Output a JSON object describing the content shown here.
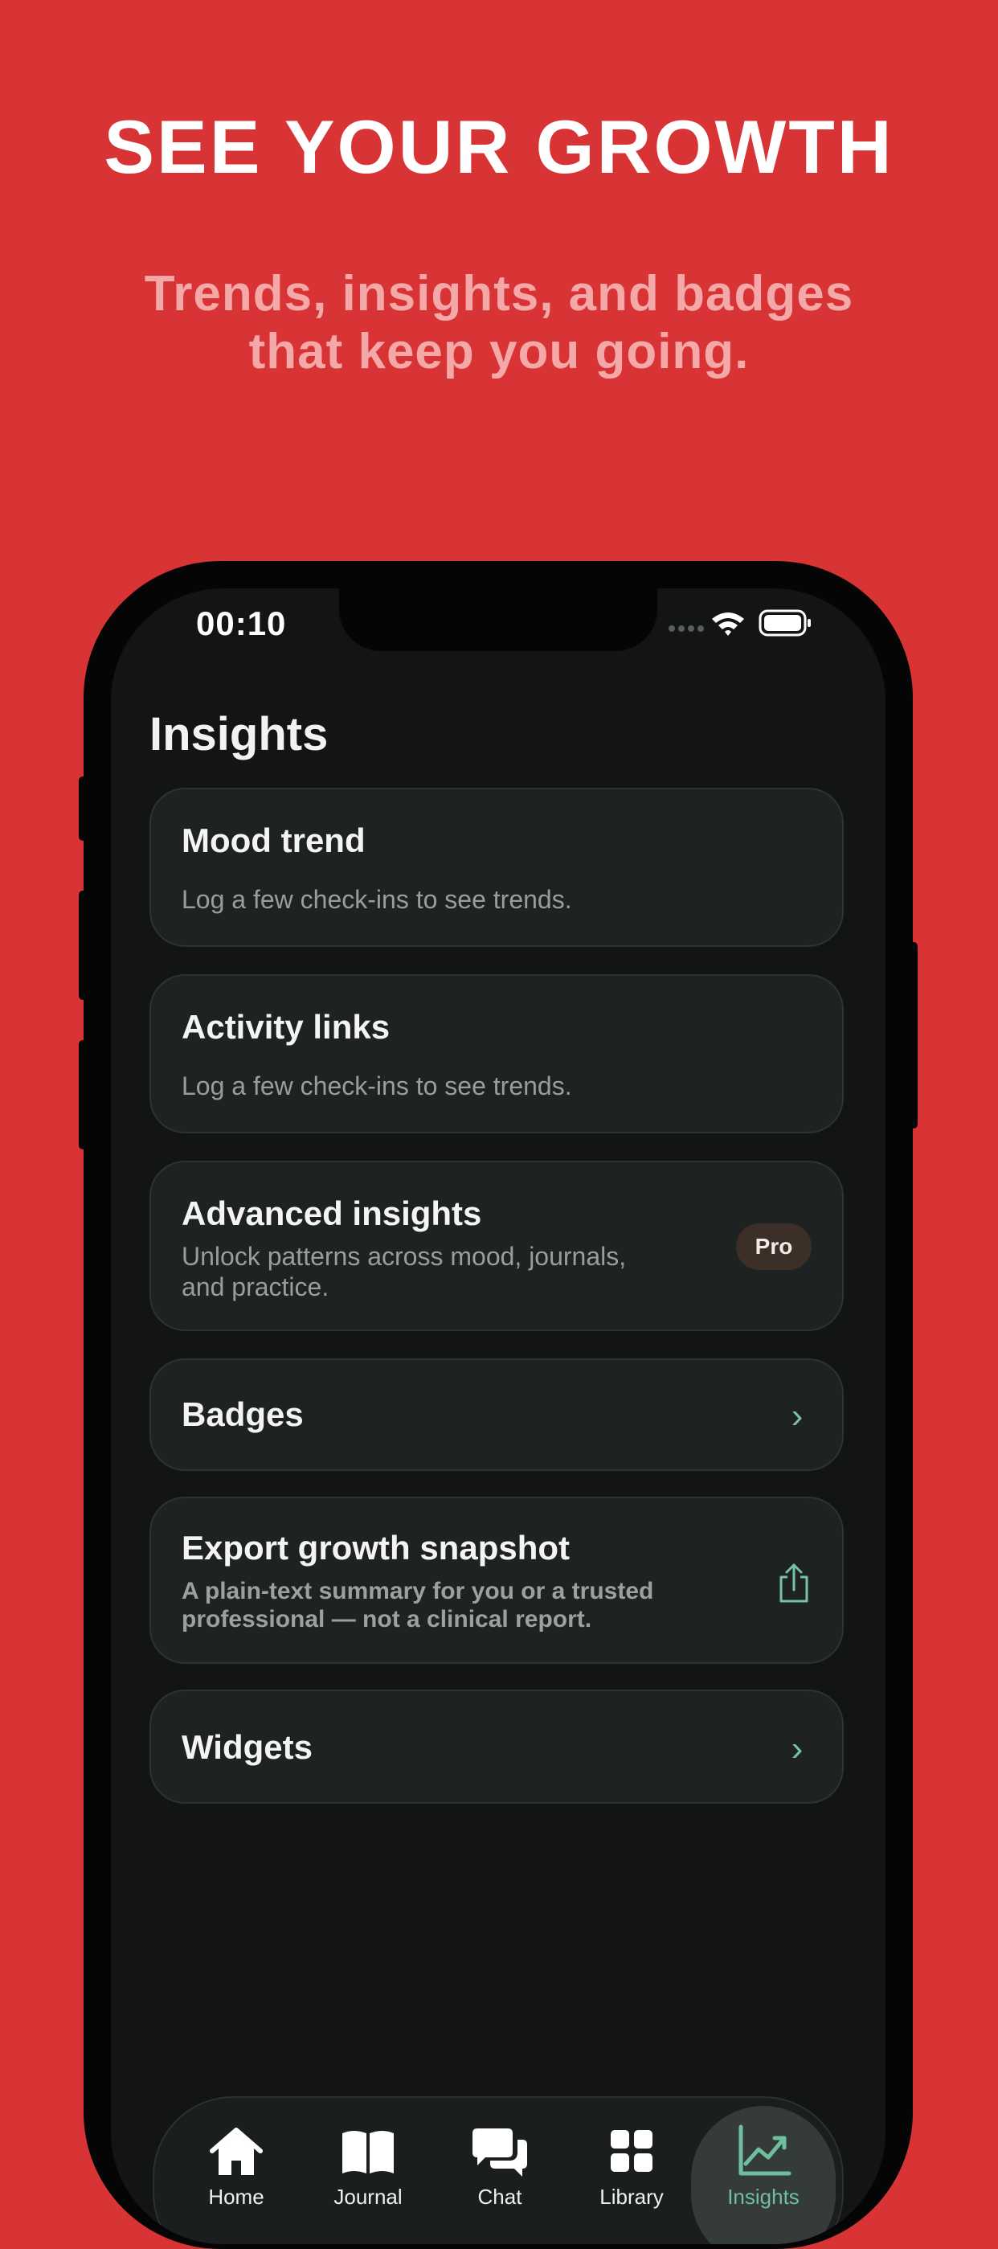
{
  "promo": {
    "headline": "SEE YOUR GROWTH",
    "subhead_line1": "Trends, insights, and badges",
    "subhead_line2": "that keep you going."
  },
  "status_bar": {
    "time": "00:10"
  },
  "screen": {
    "title": "Insights"
  },
  "cards": {
    "mood": {
      "title": "Mood trend",
      "subtitle": "Log a few check-ins to see trends."
    },
    "activity": {
      "title": "Activity links",
      "subtitle": "Log a few check-ins to see trends."
    },
    "advanced": {
      "title": "Advanced insights",
      "subtitle_line1": "Unlock patterns across mood, journals,",
      "subtitle_line2": "and practice.",
      "badge": "Pro"
    },
    "badges": {
      "title": "Badges"
    },
    "export": {
      "title": "Export growth snapshot",
      "subtitle_line1": "A plain-text summary for you or a trusted",
      "subtitle_line2": "professional — not a clinical report."
    },
    "widgets": {
      "title": "Widgets"
    }
  },
  "tabs": [
    {
      "label": "Home",
      "icon": "house-icon"
    },
    {
      "label": "Journal",
      "icon": "book-icon"
    },
    {
      "label": "Chat",
      "icon": "chat-bubbles-icon"
    },
    {
      "label": "Library",
      "icon": "grid-icon"
    },
    {
      "label": "Insights",
      "icon": "chart-trend-icon",
      "active": true
    }
  ],
  "colors": {
    "background": "#d83435",
    "accent": "#6fbf9f",
    "card": "#1f2222",
    "screen": "#131515"
  }
}
